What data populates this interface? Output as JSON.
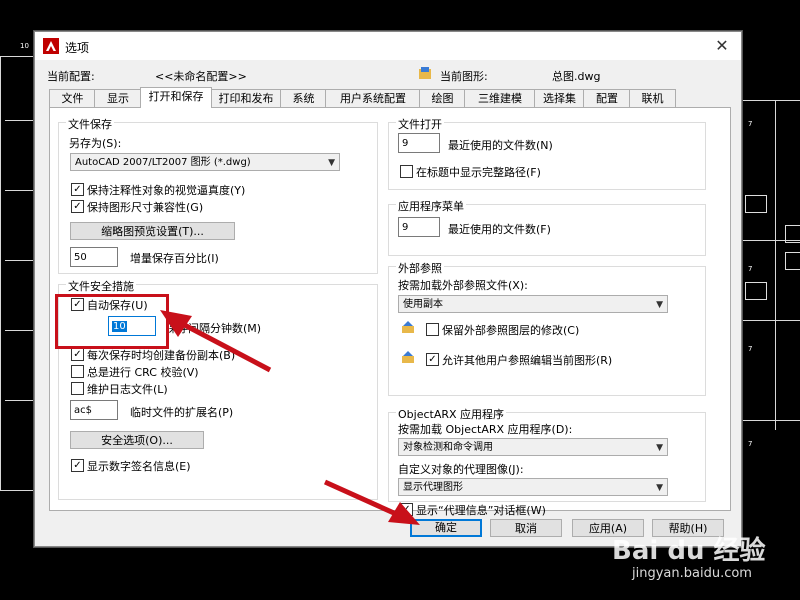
{
  "window": {
    "title": "选项",
    "close_symbol": "✕"
  },
  "config_row": {
    "current_config_label": "当前配置:",
    "current_config_value": "<<未命名配置>>",
    "current_drawing_label": "当前图形:",
    "current_drawing_value": "总图.dwg"
  },
  "tabs": [
    "文件",
    "显示",
    "打开和保存",
    "打印和发布",
    "系统",
    "用户系统配置",
    "绘图",
    "三维建模",
    "选择集",
    "配置",
    "联机"
  ],
  "active_tab": "打开和保存",
  "file_save": {
    "title": "文件保存",
    "save_as_label": "另存为(S):",
    "save_as_value": "AutoCAD 2007/LT2007 图形 (*.dwg)",
    "keep_annotative": "保持注释性对象的视觉逼真度(Y)",
    "keep_size_compat": "保持图形尺寸兼容性(G)",
    "thumbnail_button": "缩略图预览设置(T)...",
    "incremental_value": "50",
    "incremental_label": "增量保存百分比(I)"
  },
  "file_safety": {
    "title": "文件安全措施",
    "autosave_label": "自动保存(U)",
    "autosave_minutes": "10",
    "minutes_label": "保存间隔分钟数(M)",
    "backup_label": "每次保存时均创建备份副本(B)",
    "crc_label": "总是进行 CRC 校验(V)",
    "log_label": "维护日志文件(L)",
    "temp_ext_value": "ac$",
    "temp_ext_label": "临时文件的扩展名(P)",
    "security_button": "安全选项(O)...",
    "digital_sig_label": "显示数字签名信息(E)"
  },
  "file_open": {
    "title": "文件打开",
    "recent_count": "9",
    "recent_label": "最近使用的文件数(N)",
    "fullpath_label": "在标题中显示完整路径(F)"
  },
  "app_menu": {
    "title": "应用程序菜单",
    "recent_count": "9",
    "recent_label": "最近使用的文件数(F)"
  },
  "xref": {
    "title": "外部参照",
    "demand_label": "按需加载外部参照文件(X):",
    "demand_value": "使用副本",
    "retain_label": "保留外部参照图层的修改(C)",
    "allow_edit_label": "允许其他用户参照编辑当前图形(R)"
  },
  "objectarx": {
    "title": "ObjectARX 应用程序",
    "demand_label": "按需加载 ObjectARX 应用程序(D):",
    "demand_value": "对象检测和命令调用",
    "proxy_label": "自定义对象的代理图像(J):",
    "proxy_value": "显示代理图形",
    "proxy_dialog_label": "显示“代理信息”对话框(W)"
  },
  "buttons": {
    "ok": "确定",
    "cancel": "取消",
    "apply": "应用(A)",
    "help": "帮助(H)"
  },
  "background_labels": {
    "left_marker": "10",
    "r1": "7",
    "r2": "7",
    "r3": "7",
    "r4": "7"
  },
  "watermark": {
    "brand": "Bai du 经验",
    "site": "jingyan.baidu.com"
  },
  "colors": {
    "accent": "#0078d7",
    "annotation_red": "#c8101a",
    "autocad_red": "#c00000"
  }
}
